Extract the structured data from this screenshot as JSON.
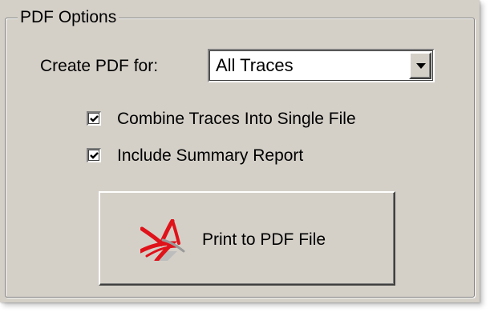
{
  "group": {
    "title": "PDF Options"
  },
  "create_pdf": {
    "label": "Create PDF for:",
    "selected": "All Traces"
  },
  "options": {
    "combine": {
      "label": "Combine Traces Into Single File",
      "checked": true
    },
    "summary": {
      "label": "Include Summary Report",
      "checked": true
    }
  },
  "print_button": {
    "label": "Print to PDF File",
    "icon": "adobe-pdf-icon"
  },
  "colors": {
    "panel": "#d4d0c8",
    "pdf_red": "#e0121a"
  }
}
